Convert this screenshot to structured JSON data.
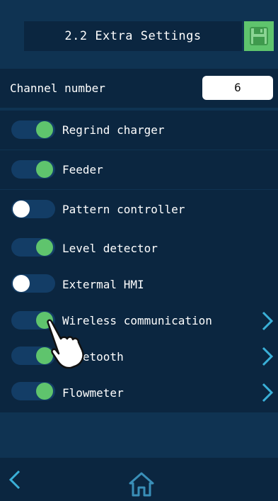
{
  "header": {
    "title": "2.2 Extra Settings",
    "save_icon": "floppy-disk-icon"
  },
  "channel": {
    "label": "Channel number",
    "value": "6"
  },
  "items": [
    {
      "label": "Regrind charger",
      "state": "on",
      "has_chevron": false
    },
    {
      "label": "Feeder",
      "state": "on",
      "has_chevron": false
    },
    {
      "label": "Pattern controller",
      "state": "off",
      "has_chevron": false
    },
    {
      "label": "Level detector",
      "state": "on",
      "has_chevron": false
    },
    {
      "label": "Extermal HMI",
      "state": "off",
      "has_chevron": false
    },
    {
      "label": "Wireless communication",
      "state": "on",
      "has_chevron": true
    },
    {
      "label": "Bluetooth",
      "state": "on",
      "has_chevron": true
    },
    {
      "label": "Flowmeter",
      "state": "on",
      "has_chevron": true
    }
  ],
  "footer": {
    "back_icon": "chevron-left-icon",
    "home_icon": "home-icon"
  },
  "colors": {
    "background": "#0f3352",
    "row": "#0b2640",
    "accent_green": "#5fc46d",
    "chevron": "#3ab0d8"
  }
}
